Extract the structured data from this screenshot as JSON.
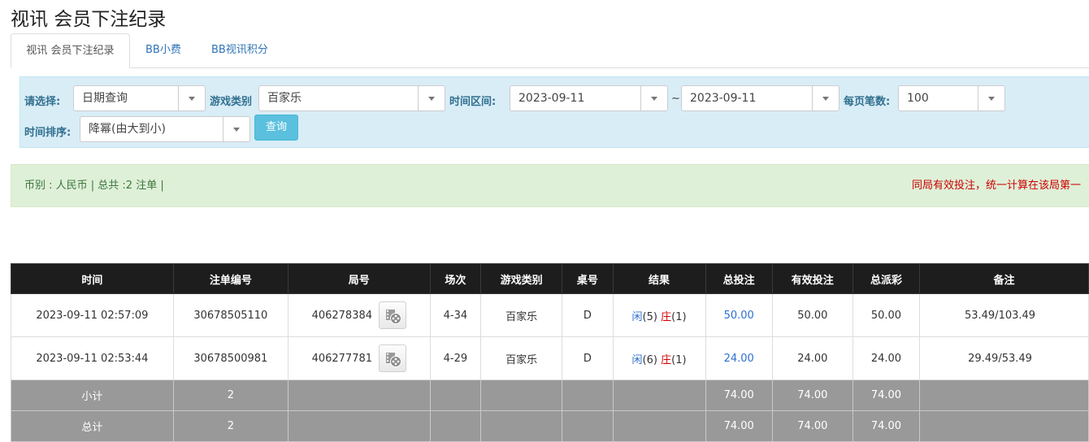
{
  "page": {
    "title": "视讯 会员下注纪录"
  },
  "tabs": [
    {
      "label": "视讯 会员下注纪录",
      "active": true
    },
    {
      "label": "BB小费",
      "active": false
    },
    {
      "label": "BB视讯积分",
      "active": false
    }
  ],
  "filter": {
    "select_label": "请选择:",
    "select_value": "日期查询",
    "game_type_label": "游戏类别",
    "game_type_value": "百家乐",
    "range_label": "时间区间:",
    "date_from": "2023-09-11",
    "range_sep": "~",
    "date_to": "2023-09-11",
    "page_size_label": "每页笔数:",
    "page_size_value": "100",
    "sort_label": "时间排序:",
    "sort_value": "降幂(由大到小)",
    "query_button": "查询"
  },
  "info": {
    "summary": "币别 : 人民币 | 总共 :2 注单 |",
    "notice": "同局有效投注，统一计算在该局第一"
  },
  "table": {
    "headers": [
      "时间",
      "注单编号",
      "局号",
      "场次",
      "游戏类别",
      "桌号",
      "结果",
      "总投注",
      "有效投注",
      "总派彩",
      "备注"
    ],
    "rows": [
      {
        "time": "2023-09-11 02:57:09",
        "bet_id": "30678505110",
        "round_id": "406278384",
        "session": "4-34",
        "game": "百家乐",
        "table": "D",
        "result_player_label": "闲",
        "result_player_score": "(5)",
        "result_banker_label": "庄",
        "result_banker_score": "(1)",
        "total_bet": "50.00",
        "valid_bet": "50.00",
        "payout": "50.00",
        "note": "53.49/103.49"
      },
      {
        "time": "2023-09-11 02:53:44",
        "bet_id": "30678500981",
        "round_id": "406277781",
        "session": "4-29",
        "game": "百家乐",
        "table": "D",
        "result_player_label": "闲",
        "result_player_score": "(6)",
        "result_banker_label": "庄",
        "result_banker_score": "(1)",
        "total_bet": "24.00",
        "valid_bet": "24.00",
        "payout": "24.00",
        "note": "29.49/53.49"
      }
    ],
    "subtotal": {
      "label": "小计",
      "count": "2",
      "total_bet": "74.00",
      "valid_bet": "74.00",
      "payout": "74.00"
    },
    "grandtotal": {
      "label": "总计",
      "count": "2",
      "total_bet": "74.00",
      "valid_bet": "74.00",
      "payout": "74.00"
    }
  },
  "icons": {
    "replay": "film-reel-icon",
    "dropdown": "caret-down-icon"
  },
  "colors": {
    "header_bg": "#1d1d1d",
    "filter_bg": "#d9edf7",
    "info_bg": "#dff0d8",
    "summary_bg": "#999999",
    "link_blue": "#2f74b5",
    "banker_red": "#d40000"
  }
}
